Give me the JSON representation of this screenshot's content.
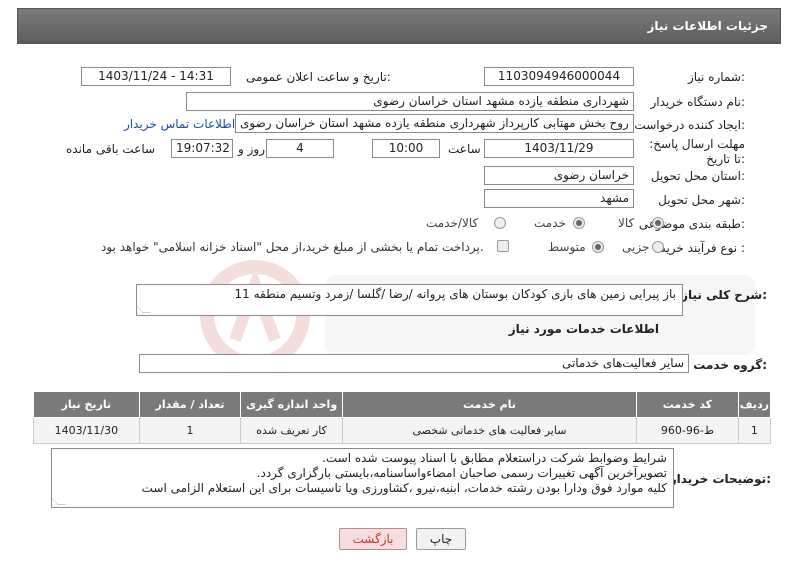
{
  "header": {
    "title": "جزئیات اطلاعات نیاز"
  },
  "form": {
    "need_number_label": "شماره نیاز:",
    "need_number": "1103094946000044",
    "announce_label": "تاریخ و ساعت اعلان عمومی:",
    "announce_value": "1403/11/24 - 14:31",
    "buyer_label": "نام دستگاه خریدار:",
    "buyer_value": "شهرداری منطقه یازده مشهد استان خراسان رضوی",
    "creator_label": "ایجاد کننده درخواست:",
    "creator_value": "سلمان روح بخش مهتابی کارپرداز شهرداری منطقه یازده مشهد استان خراسان رضوی",
    "contact_link": "اطلاعات تماس خریدار",
    "deadline_label": "مهلت ارسال پاسخ: تا تاریخ:",
    "deadline_date": "1403/11/29",
    "time_label": "ساعت",
    "deadline_time": "10:00",
    "days_value": "4",
    "days_label": "روز و",
    "remaining_time": "19:07:32",
    "remaining_label": "ساعت باقی مانده",
    "province_label": "استان محل تحویل:",
    "province_value": "خراسان رضوی",
    "city_label": "شهر محل تحویل:",
    "city_value": "مشهد",
    "category_label": "طبقه بندی موضوعی:",
    "category_options": [
      "کالا",
      "خدمت",
      "کالا/خدمت"
    ],
    "process_label": "نوع فرآیند خرید :",
    "process_options": [
      "جزیی",
      "متوسط"
    ],
    "payment_note": "پرداخت تمام یا بخشی از مبلغ خرید،از محل \"اسناد خزانه اسلامی\" خواهد بود."
  },
  "summary": {
    "label": "شرح کلی نیاز:",
    "value": "باز پیرایی زمین های بازی کودکان بوستان های پروانه /رضا /گلسا /زمرد وتسیم منطقه 11"
  },
  "services": {
    "section_title": "اطلاعات خدمات مورد نیاز",
    "group_label": "گروه خدمت:",
    "group_value": "سایر فعالیت‌های خدماتی",
    "columns": [
      "ردیف",
      "کد خدمت",
      "نام خدمت",
      "واحد اندازه گیری",
      "تعداد / مقدار",
      "تاریخ نیاز"
    ],
    "rows": [
      [
        "1",
        "ط-96-960",
        "سایر فعالیت های خدماتی شخصی",
        "کار تعریف شده",
        "1",
        "1403/11/30"
      ]
    ]
  },
  "buyer_notes": {
    "label": "توضیحات خریدار:",
    "lines": [
      "شرایط وضوابط شرکت دراستعلام مطابق با اسناد پیوست شده است.",
      "تصویرآخرین آگهی تغییرات رسمی صاحبان امضاءواساسنامه،بایستی بارگزاری گردد.",
      "کلیه موارد فوق ودارا بودن رشته خدمات، ابنیه،نیرو ،کشاورزی  ویا تاسیسات برای این استعلام الزامی است"
    ]
  },
  "buttons": {
    "print": "چاپ",
    "back": "بازگشت"
  },
  "colors": {
    "header_bg": "#6b6b6b",
    "link": "#1a4fa8",
    "back_text": "#c0392b"
  }
}
